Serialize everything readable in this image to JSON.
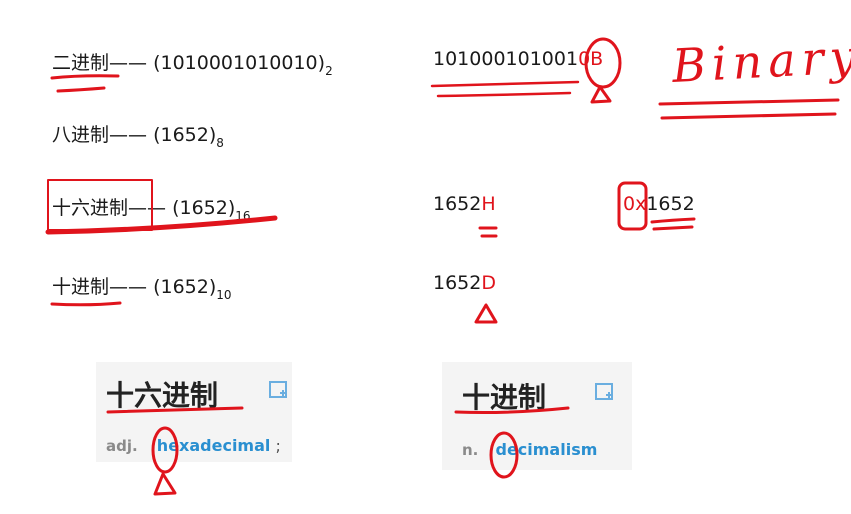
{
  "rows": [
    {
      "name": "binary",
      "cn": "二进制",
      "dash": "——",
      "open": "(",
      "value": "1010001010010",
      "close": ")",
      "base": "2"
    },
    {
      "name": "octal",
      "cn": "八进制",
      "dash": "——",
      "open": "(",
      "value": "1652",
      "close": ")",
      "base": "8"
    },
    {
      "name": "hex",
      "cn": "十六进制",
      "dash": "——",
      "open": "(",
      "value": "1652",
      "close": ")",
      "base": "16"
    },
    {
      "name": "decimal",
      "cn": "十进制",
      "dash": "——",
      "open": "(",
      "value": "1652",
      "close": ")",
      "base": "10"
    }
  ],
  "notations": {
    "binary": {
      "number": "101000101001",
      "suffix": "0B"
    },
    "hex_suffix": {
      "number": "1652",
      "suffix": "H"
    },
    "hex_prefix": {
      "prefix": "0x",
      "number": "1652"
    },
    "decimal": {
      "number": "1652",
      "suffix": "D"
    }
  },
  "handwriting": {
    "binary_word": "Binary"
  },
  "dict_cards": [
    {
      "word": "十六进制",
      "pos": "adj.",
      "definition": "hexadecimal",
      "separator": ";"
    },
    {
      "word": "十进制",
      "pos": "n.",
      "definition": "decimalism"
    }
  ],
  "colors": {
    "ink": "#e0141c",
    "link": "#2a8fd0",
    "text": "#1a1a1a"
  }
}
